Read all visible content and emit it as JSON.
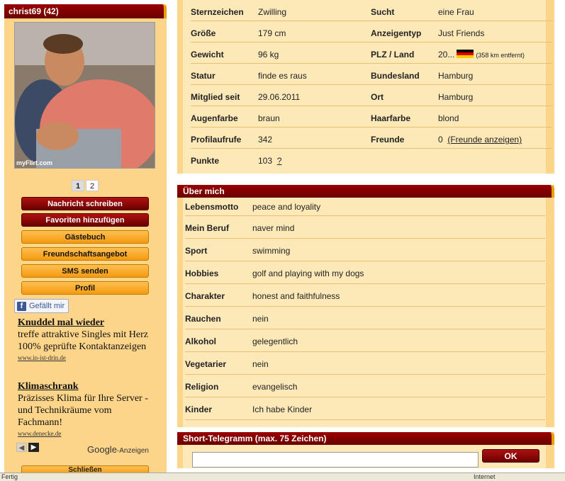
{
  "profile": {
    "username_header": "christ69 (42)",
    "photo_watermark": "myFlirt.com",
    "pages": [
      "1",
      "2"
    ],
    "buttons": {
      "message": "Nachricht schreiben",
      "favorite": "Favoriten hinzufügen",
      "guestbook": "Gästebuch",
      "friendship": "Freundschaftsangebot",
      "sms": "SMS senden",
      "profile": "Profil",
      "close": "Schließen"
    },
    "facebook_like": "Gefällt mir"
  },
  "ads": [
    {
      "title": "Knuddel mal wieder",
      "text": "treffe attraktive Singles mit Herz 100% geprüfte Kontaktanzeigen",
      "url": "www.in-ist-drin.de"
    },
    {
      "title": "Klimaschrank",
      "text": "Präzisses Klima für Ihre Server - und Technikräume vom Fachmann!",
      "url": "www.denecke.de"
    }
  ],
  "google_ads": {
    "brand": "Google",
    "suffix": "-Anzeigen"
  },
  "info": {
    "rows": [
      {
        "k": "Sternzeichen",
        "v": "Zwilling",
        "k2": "Sucht",
        "v2": "eine Frau"
      },
      {
        "k": "Größe",
        "v": "179 cm",
        "k2": "Anzeigentyp",
        "v2": "Just Friends"
      },
      {
        "k": "Gewicht",
        "v": "96 kg",
        "k2": "PLZ / Land",
        "v2": "20...",
        "distance": "(358 km entfernt)"
      },
      {
        "k": "Statur",
        "v": "finde es raus",
        "k2": "Bundesland",
        "v2": "Hamburg"
      },
      {
        "k": "Mitglied seit",
        "v": "29.06.2011",
        "k2": "Ort",
        "v2": "Hamburg"
      },
      {
        "k": "Augenfarbe",
        "v": "braun",
        "k2": "Haarfarbe",
        "v2": "blond"
      },
      {
        "k": "Profilaufrufe",
        "v": "342",
        "k2": "Freunde",
        "v2": "0",
        "link": "(Freunde anzeigen)"
      },
      {
        "k": "Punkte",
        "v": "103",
        "help": "?"
      }
    ]
  },
  "about": {
    "title": "Über mich",
    "rows": [
      {
        "k": "Lebensmotto",
        "v": "peace and loyality"
      },
      {
        "k": "Mein Beruf",
        "v": "naver mind"
      },
      {
        "k": "Sport",
        "v": "swimming"
      },
      {
        "k": "Hobbies",
        "v": "golf and playing with my dogs"
      },
      {
        "k": "Charakter",
        "v": "honest and faithfulness"
      },
      {
        "k": "Rauchen",
        "v": "nein"
      },
      {
        "k": "Alkohol",
        "v": "gelegentlich"
      },
      {
        "k": "Vegetarier",
        "v": "nein"
      },
      {
        "k": "Religion",
        "v": "evangelisch"
      },
      {
        "k": "Kinder",
        "v": "Ich habe Kinder"
      }
    ]
  },
  "telegram": {
    "title": "Short-Telegramm (max. 75 Zeichen)",
    "placeholder": "",
    "ok": "OK"
  },
  "statusbar": {
    "left": "Fertig",
    "right": "Internet"
  },
  "colors": {
    "panel": "#fdd58a",
    "header": "#8b0000",
    "accent_button": "#f39a10"
  }
}
